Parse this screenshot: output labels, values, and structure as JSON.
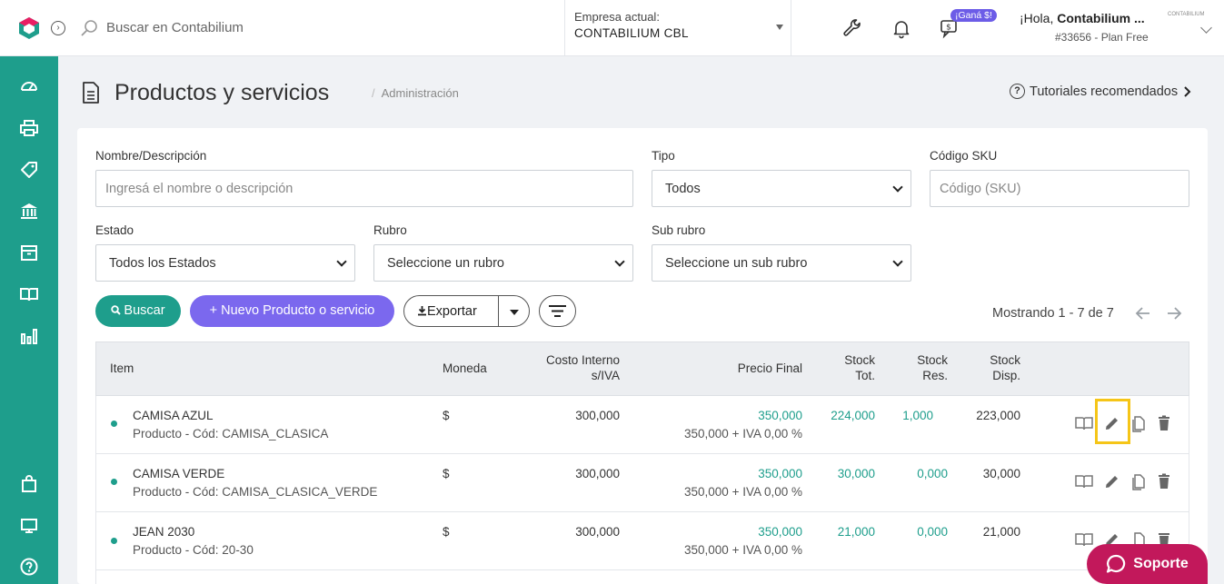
{
  "topbar": {
    "search_placeholder": "Buscar en Contabilium",
    "company_label": "Empresa actual:",
    "company_name": "CONTABILIUM CBL",
    "gana_badge": "¡Ganá $!",
    "greeting": "¡Hola,",
    "user_name": "Contabilium ...",
    "mini_logo": "CONTABILIUM",
    "plan": "#33656 - Plan Free"
  },
  "sidebar": {
    "items": [
      "dashboard-icon",
      "printer-icon",
      "tag-icon",
      "bank-icon",
      "box-icon",
      "book-icon",
      "chart-icon"
    ],
    "bottom": [
      "bag-icon",
      "monitor-icon",
      "help-icon"
    ]
  },
  "header": {
    "title": "Productos y servicios",
    "breadcrumb_sep": "/",
    "breadcrumb": "Administración",
    "tutorials": "Tutoriales recomendados"
  },
  "filters": {
    "name_label": "Nombre/Descripción",
    "name_placeholder": "Ingresá el nombre o descripción",
    "tipo_label": "Tipo",
    "tipo_value": "Todos",
    "sku_label": "Código SKU",
    "sku_placeholder": "Código (SKU)",
    "estado_label": "Estado",
    "estado_value": "Todos los Estados",
    "rubro_label": "Rubro",
    "rubro_value": "Seleccione un rubro",
    "subrubro_label": "Sub rubro",
    "subrubro_value": "Seleccione un sub rubro"
  },
  "toolbar": {
    "buscar": "Buscar",
    "nuevo": "+ Nuevo Producto o servicio",
    "exportar": "Exportar",
    "showing": "Mostrando 1 - 7 de 7"
  },
  "table": {
    "headers": {
      "item": "Item",
      "moneda": "Moneda",
      "costo_1": "Costo Interno",
      "costo_2": "s/IVA",
      "precio": "Precio Final",
      "stock_tot_1": "Stock",
      "stock_tot_2": "Tot.",
      "stock_res_1": "Stock",
      "stock_res_2": "Res.",
      "stock_disp_1": "Stock",
      "stock_disp_2": "Disp."
    },
    "rows": [
      {
        "name": "CAMISA AZUL",
        "detail": "Producto - Cód: CAMISA_CLASICA",
        "moneda": "$",
        "costo": "300,000",
        "precio": "350,000",
        "precio_detail": "350,000 + IVA 0,00 %",
        "stock_tot": "224,000",
        "stock_res": "1,000",
        "stock_disp": "223,000"
      },
      {
        "name": "CAMISA VERDE",
        "detail": "Producto - Cód: CAMISA_CLASICA_VERDE",
        "moneda": "$",
        "costo": "300,000",
        "precio": "350,000",
        "precio_detail": "350,000 + IVA 0,00 %",
        "stock_tot": "30,000",
        "stock_res": "0,000",
        "stock_disp": "30,000"
      },
      {
        "name": "JEAN 2030",
        "detail": "Producto - Cód: 20-30",
        "moneda": "$",
        "costo": "300,000",
        "precio": "350,000",
        "precio_detail": "350,000 + IVA 0,00 %",
        "stock_tot": "21,000",
        "stock_res": "0,000",
        "stock_disp": "21,000"
      }
    ]
  },
  "soporte": "Soporte",
  "colors": {
    "teal": "#1e9e8c",
    "purple": "#7b68ee",
    "soporte": "#c2185b",
    "highlight": "#f5c518"
  }
}
